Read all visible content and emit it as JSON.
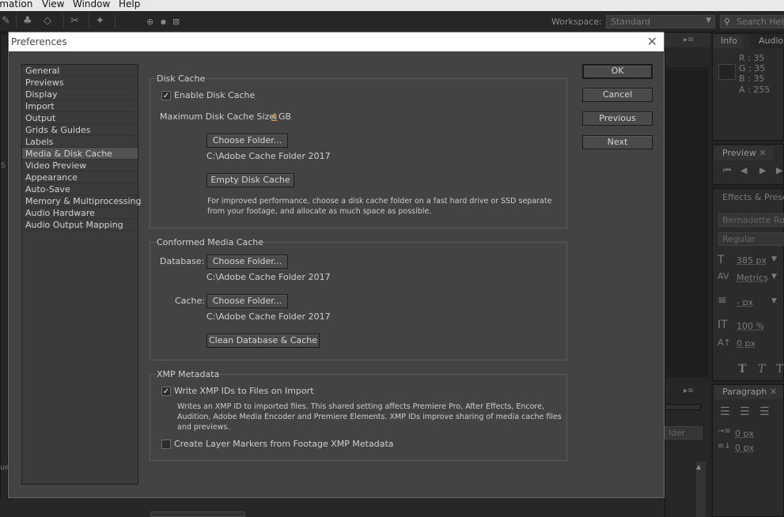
{
  "menubar": {
    "items": [
      "imation",
      "View",
      "Window",
      "Help"
    ]
  },
  "workspace": {
    "label": "Workspace:",
    "value": "Standard"
  },
  "search": {
    "placeholder": "Search Help"
  },
  "info_panel": {
    "tabs": [
      "Info",
      "Audio"
    ],
    "r": "R : 35",
    "g": "G : 35",
    "b": "B : 35",
    "a": "A : 255",
    "swatch_color": "#232323"
  },
  "preview_panel": {
    "tab": "Preview"
  },
  "effects_panel": {
    "tab": "Effects & Prese"
  },
  "character_panel": {
    "font": "Bernadette Rou",
    "style": "Regular",
    "size": "385 px",
    "kerning": "Metrics",
    "leading": "- px",
    "vscale": "100 %",
    "baseline": "0 px"
  },
  "paragraph_panel": {
    "tab": "Paragraph",
    "indent1": "0 px",
    "indent2": "0 px"
  },
  "left_panel_fragments": {
    "s": "S",
    "u": "ue",
    "folder": "lder"
  },
  "dialog": {
    "title": "Preferences",
    "categories": [
      "General",
      "Previews",
      "Display",
      "Import",
      "Output",
      "Grids & Guides",
      "Labels",
      "Media & Disk Cache",
      "Video Preview",
      "Appearance",
      "Auto-Save",
      "Memory & Multiprocessing",
      "Audio Hardware",
      "Audio Output Mapping"
    ],
    "selected_category": "Media & Disk Cache",
    "buttons": {
      "ok": "OK",
      "cancel": "Cancel",
      "previous": "Previous",
      "next": "Next"
    },
    "disk_cache": {
      "legend": "Disk Cache",
      "enable_label": "Enable Disk Cache",
      "enable_checked": true,
      "max_size_label": "Maximum Disk Cache Size:",
      "max_size_value": "4",
      "max_size_unit": "GB",
      "choose_folder": "Choose Folder...",
      "path": "C:\\Adobe Cache Folder 2017",
      "empty_cache": "Empty Disk Cache",
      "note_line1": "For improved performance, choose a disk cache folder on a fast hard drive or SSD separate",
      "note_line2": "from your footage, and allocate as much space as possible."
    },
    "conformed_cache": {
      "legend": "Conformed Media Cache",
      "database_label": "Database:",
      "database_button": "Choose Folder...",
      "database_path": "C:\\Adobe Cache Folder 2017",
      "cache_label": "Cache:",
      "cache_button": "Choose Folder...",
      "cache_path": "C:\\Adobe Cache Folder 2017",
      "clean_button": "Clean Database & Cache"
    },
    "xmp": {
      "legend": "XMP Metadata",
      "write_label": "Write XMP IDs to Files on Import",
      "write_checked": true,
      "note_line1": "Writes an XMP ID to imported files. This shared setting affects Premiere Pro, After Effects, Encore,",
      "note_line2": "Audition, Adobe Media Encoder and Premiere Elements. XMP IDs improve sharing of media cache files",
      "note_line3": "and previews.",
      "markers_label": "Create Layer Markers from Footage XMP Metadata",
      "markers_checked": false
    }
  }
}
